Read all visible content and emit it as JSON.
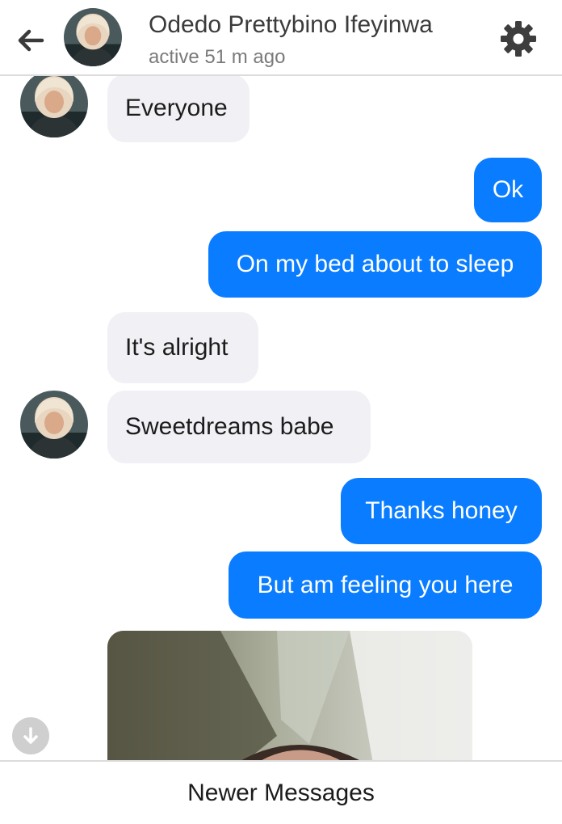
{
  "header": {
    "contact_name": "Odedo Prettybino Ifeyinwa",
    "status": "active 51 m ago",
    "back_icon": "arrow-left-icon",
    "settings_icon": "gear-icon"
  },
  "messages": [
    {
      "direction": "incoming",
      "text": "Everyone",
      "show_avatar": true
    },
    {
      "direction": "outgoing",
      "text": "Ok"
    },
    {
      "direction": "outgoing",
      "text": "On my bed about to sleep"
    },
    {
      "direction": "incoming",
      "text": "It's alright",
      "show_avatar": false
    },
    {
      "direction": "incoming",
      "text": "Sweetdreams babe",
      "show_avatar": true
    },
    {
      "direction": "outgoing",
      "text": "Thanks honey"
    },
    {
      "direction": "outgoing",
      "text": "But am feeling you here"
    },
    {
      "direction": "incoming",
      "type": "photo"
    }
  ],
  "scroll_down_icon": "arrow-down-circle-icon",
  "footer": {
    "newer_messages_label": "Newer Messages"
  },
  "colors": {
    "outgoing_bubble": "#0a7cff",
    "incoming_bubble": "#f1f0f5",
    "divider": "#dcdcdc"
  }
}
